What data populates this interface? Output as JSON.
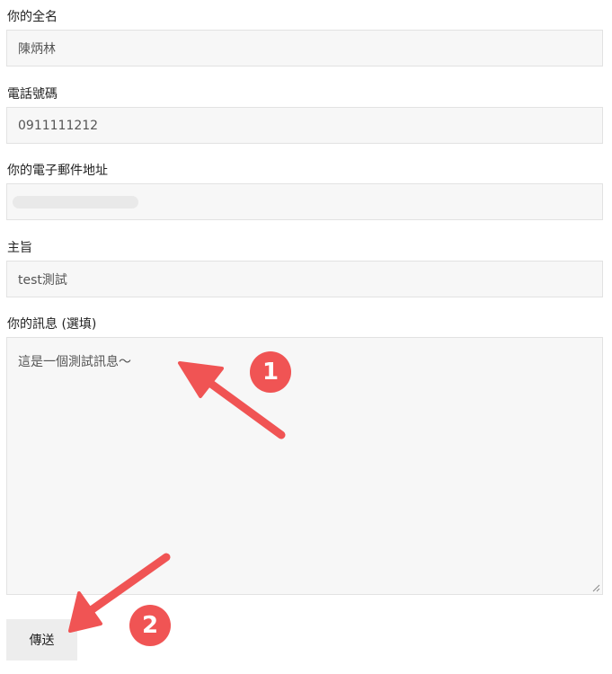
{
  "form": {
    "name_label": "你的全名",
    "name_value": "陳炳林",
    "phone_label": "電話號碼",
    "phone_value": "0911111212",
    "email_label": "你的電子郵件地址",
    "subject_label": "主旨",
    "subject_value": "test測試",
    "message_label": "你的訊息 (選填)",
    "message_value": "這是一個測試訊息～",
    "submit_label": "傳送"
  },
  "annotations": {
    "step1": "1",
    "step2": "2",
    "color": "#f05454"
  }
}
